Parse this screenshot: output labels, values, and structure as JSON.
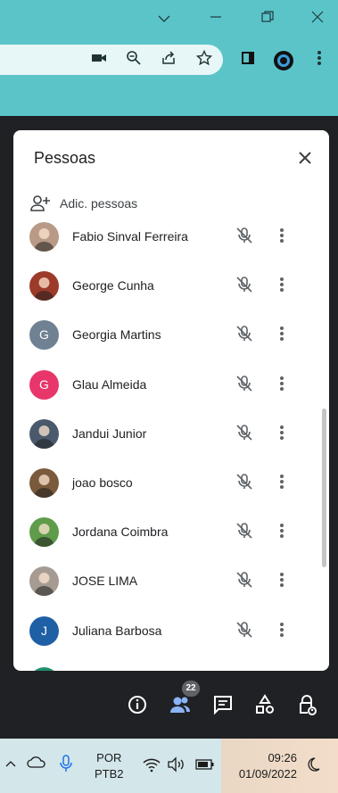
{
  "panel": {
    "title": "Pessoas",
    "add_people": "Adic. pessoas"
  },
  "participants": [
    {
      "name": "Fabio Sinval Ferreira",
      "avatar_type": "photo",
      "avatar_color": "#b89a86"
    },
    {
      "name": "George Cunha",
      "avatar_type": "photo",
      "avatar_color": "#9c3b2a"
    },
    {
      "name": "Georgia Martins",
      "avatar_type": "letter",
      "initial": "G",
      "avatar_color": "#6f8193"
    },
    {
      "name": "Glau Almeida",
      "avatar_type": "letter",
      "initial": "G",
      "avatar_color": "#e8366a"
    },
    {
      "name": "Jandui Junior",
      "avatar_type": "photo",
      "avatar_color": "#4a5a6c"
    },
    {
      "name": "joao bosco",
      "avatar_type": "photo",
      "avatar_color": "#7a5a3c"
    },
    {
      "name": "Jordana Coimbra",
      "avatar_type": "photo",
      "avatar_color": "#5f9c4a"
    },
    {
      "name": "JOSE LIMA",
      "avatar_type": "photo",
      "avatar_color": "#a59b93"
    },
    {
      "name": "Juliana Barbosa",
      "avatar_type": "letter",
      "initial": "J",
      "avatar_color": "#1f5fa5"
    }
  ],
  "meeting_bar": {
    "people_count": "22"
  },
  "taskbar": {
    "lang_line1": "POR",
    "lang_line2": "PTB2",
    "time": "09:26",
    "date": "01/09/2022"
  },
  "colors": {
    "browser_accent": "#5bc4c9",
    "people_active": "#8ab4f8",
    "meet_background": "#202124"
  }
}
